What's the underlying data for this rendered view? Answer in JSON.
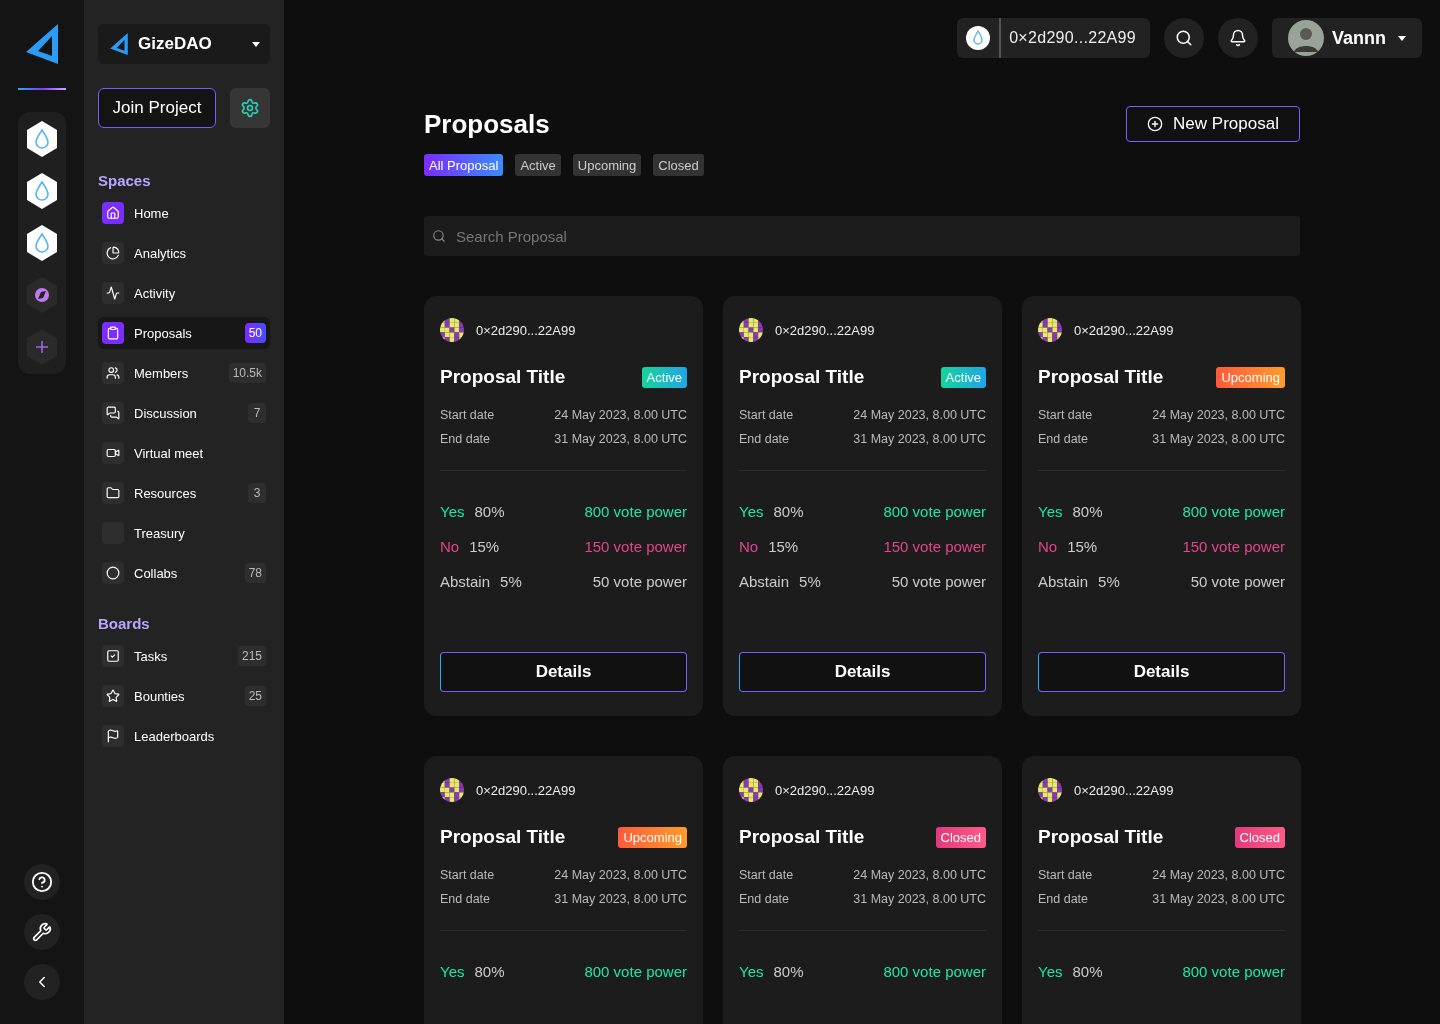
{
  "rail": {
    "spaces": [
      {
        "kind": "drop"
      },
      {
        "kind": "drop"
      },
      {
        "kind": "drop"
      },
      {
        "kind": "compass"
      },
      {
        "kind": "add"
      }
    ],
    "bottom": [
      {
        "kind": "help"
      },
      {
        "kind": "wrench"
      },
      {
        "kind": "collapse"
      }
    ]
  },
  "sidebar": {
    "project": "GizeDAO",
    "join_button": "Join Project",
    "sections": [
      {
        "title": "Spaces",
        "items": [
          {
            "label": "Home",
            "accent": true,
            "selected": false
          },
          {
            "label": "Analytics",
            "accent": false,
            "selected": false
          },
          {
            "label": "Activity",
            "accent": false,
            "selected": false
          },
          {
            "label": "Proposals",
            "count": "50",
            "accent": true,
            "selected": true
          },
          {
            "label": "Members",
            "count": "10.5k",
            "accent": false,
            "selected": false
          },
          {
            "label": "Discussion",
            "count": "7",
            "accent": false,
            "selected": false
          },
          {
            "label": "Virtual meet",
            "accent": false,
            "selected": false
          },
          {
            "label": "Resources",
            "count": "3",
            "accent": false,
            "selected": false
          },
          {
            "label": "Treasury",
            "accent": false,
            "selected": false
          },
          {
            "label": "Collabs",
            "count": "78",
            "accent": false,
            "selected": false
          }
        ]
      },
      {
        "title": "Boards",
        "items": [
          {
            "label": "Tasks",
            "count": "215",
            "accent": false,
            "selected": false
          },
          {
            "label": "Bounties",
            "count": "25",
            "accent": false,
            "selected": false
          },
          {
            "label": "Leaderboards",
            "accent": false,
            "selected": false
          }
        ]
      }
    ]
  },
  "topbar": {
    "wallet": "0×2d290...22A99",
    "user": "Vannn"
  },
  "page": {
    "title": "Proposals",
    "new_button": "New Proposal",
    "filters": [
      {
        "label": "All Proposal",
        "selected": true
      },
      {
        "label": "Active",
        "selected": false
      },
      {
        "label": "Upcoming",
        "selected": false
      },
      {
        "label": "Closed",
        "selected": false
      }
    ],
    "search": {
      "placeholder": "Search Proposal"
    }
  },
  "cards": [
    {
      "author": "0×2d290...22A99",
      "title": "Proposal Title",
      "status": {
        "label": "Active",
        "kind": "active"
      },
      "dates": [
        {
          "label": "Start date",
          "value": "24 May 2023, 8.00 UTC"
        },
        {
          "label": "End date",
          "value": "31 May 2023, 8.00 UTC"
        }
      ],
      "votes": [
        {
          "kind": "yes",
          "label": "Yes",
          "percent": "80%",
          "power": "800 vote power"
        },
        {
          "kind": "no",
          "label": "No",
          "percent": "15%",
          "power": "150 vote power"
        },
        {
          "kind": "abstain",
          "label": "Abstain",
          "percent": "5%",
          "power": "50 vote power"
        }
      ],
      "button": "Details"
    },
    {
      "author": "0×2d290...22A99",
      "title": "Proposal Title",
      "status": {
        "label": "Active",
        "kind": "active"
      },
      "dates": [
        {
          "label": "Start date",
          "value": "24 May 2023, 8.00 UTC"
        },
        {
          "label": "End date",
          "value": "31 May 2023, 8.00 UTC"
        }
      ],
      "votes": [
        {
          "kind": "yes",
          "label": "Yes",
          "percent": "80%",
          "power": "800 vote power"
        },
        {
          "kind": "no",
          "label": "No",
          "percent": "15%",
          "power": "150 vote power"
        },
        {
          "kind": "abstain",
          "label": "Abstain",
          "percent": "5%",
          "power": "50 vote power"
        }
      ],
      "button": "Details"
    },
    {
      "author": "0×2d290...22A99",
      "title": "Proposal Title",
      "status": {
        "label": "Upcoming",
        "kind": "upcoming"
      },
      "dates": [
        {
          "label": "Start date",
          "value": "24 May 2023, 8.00 UTC"
        },
        {
          "label": "End date",
          "value": "31 May 2023, 8.00 UTC"
        }
      ],
      "votes": [
        {
          "kind": "yes",
          "label": "Yes",
          "percent": "80%",
          "power": "800 vote power"
        },
        {
          "kind": "no",
          "label": "No",
          "percent": "15%",
          "power": "150 vote power"
        },
        {
          "kind": "abstain",
          "label": "Abstain",
          "percent": "5%",
          "power": "50 vote power"
        }
      ],
      "button": "Details"
    },
    {
      "author": "0×2d290...22A99",
      "title": "Proposal Title",
      "status": {
        "label": "Upcoming",
        "kind": "upcoming"
      },
      "dates": [
        {
          "label": "Start date",
          "value": "24 May 2023, 8.00 UTC"
        },
        {
          "label": "End date",
          "value": "31 May 2023, 8.00 UTC"
        }
      ],
      "votes": [
        {
          "kind": "yes",
          "label": "Yes",
          "percent": "80%",
          "power": "800 vote power"
        }
      ]
    },
    {
      "author": "0×2d290...22A99",
      "title": "Proposal Title",
      "status": {
        "label": "Closed",
        "kind": "closed"
      },
      "dates": [
        {
          "label": "Start date",
          "value": "24 May 2023, 8.00 UTC"
        },
        {
          "label": "End date",
          "value": "31 May 2023, 8.00 UTC"
        }
      ],
      "votes": [
        {
          "kind": "yes",
          "label": "Yes",
          "percent": "80%",
          "power": "800 vote power"
        }
      ]
    },
    {
      "author": "0×2d290...22A99",
      "title": "Proposal Title",
      "status": {
        "label": "Closed",
        "kind": "closed"
      },
      "dates": [
        {
          "label": "Start date",
          "value": "24 May 2023, 8.00 UTC"
        },
        {
          "label": "End date",
          "value": "31 May 2023, 8.00 UTC"
        }
      ],
      "votes": [
        {
          "kind": "yes",
          "label": "Yes",
          "percent": "80%",
          "power": "800 vote power"
        }
      ]
    }
  ]
}
